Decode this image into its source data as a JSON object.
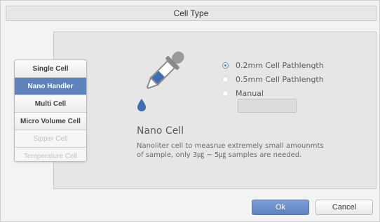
{
  "dialog": {
    "title": "Cell Type"
  },
  "sidebar": {
    "items": [
      {
        "label": "Single Cell",
        "state": "normal"
      },
      {
        "label": "Nano Handler",
        "state": "active"
      },
      {
        "label": "Multi Cell",
        "state": "normal"
      },
      {
        "label": "Micro Volume Cell",
        "state": "normal"
      },
      {
        "label": "Sipper Cell",
        "state": "disabled"
      },
      {
        "label": "Temperature Cell",
        "state": "disabled"
      }
    ]
  },
  "options": {
    "radios": [
      {
        "label": "0.2mm Cell Pathlength",
        "checked": true
      },
      {
        "label": "0.5mm Cell Pathlength",
        "checked": false
      },
      {
        "label": "Manual",
        "checked": false
      }
    ],
    "manual_value": ""
  },
  "cell_info": {
    "icon": "dropper-icon",
    "title": "Nano Cell",
    "description_line1": "Nanoliter cell to measrue extremely small amounmts",
    "description_line2": "of sample, only 3㎍ ~ 5㎍ samples are needed."
  },
  "buttons": {
    "ok": "Ok",
    "cancel": "Cancel"
  },
  "colors": {
    "accent": "#5e83bc",
    "drop": "#3f6fb2"
  }
}
